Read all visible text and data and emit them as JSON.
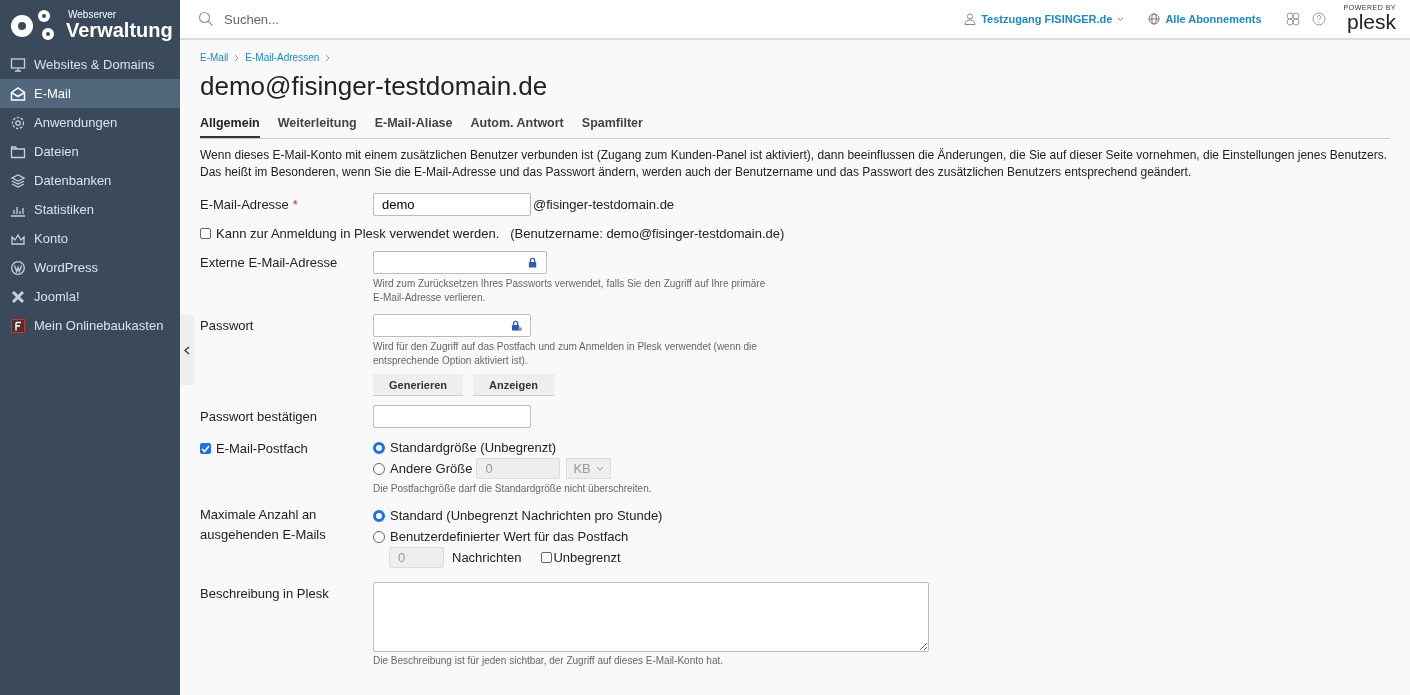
{
  "sidebar": {
    "logo": {
      "small": "Webserver",
      "big": "Verwaltung"
    },
    "items": [
      {
        "label": "Websites & Domains",
        "selected": false
      },
      {
        "label": "E-Mail",
        "selected": true
      },
      {
        "label": "Anwendungen",
        "selected": false
      },
      {
        "label": "Dateien",
        "selected": false
      },
      {
        "label": "Datenbanken",
        "selected": false
      },
      {
        "label": "Statistiken",
        "selected": false
      },
      {
        "label": "Konto",
        "selected": false
      },
      {
        "label": "WordPress",
        "selected": false
      },
      {
        "label": "Joomla!",
        "selected": false
      },
      {
        "label": "Mein Onlinebaukasten",
        "selected": false
      }
    ]
  },
  "topbar": {
    "search": {
      "placeholder": "Suchen..."
    },
    "user": "Testzugang FISINGER.de",
    "subscriptions": "Alle Abonnements",
    "powered_by": "POWERED BY",
    "brand": "plesk"
  },
  "breadcrumbs": [
    "E-Mail",
    "E-Mail-Adressen"
  ],
  "title": "demo@fisinger-testdomain.de",
  "tabs": [
    {
      "label": "Allgemein",
      "selected": true
    },
    {
      "label": "Weiterleitung",
      "selected": false
    },
    {
      "label": "E-Mail-Aliase",
      "selected": false
    },
    {
      "label": "Autom. Antwort",
      "selected": false
    },
    {
      "label": "Spamfilter",
      "selected": false
    }
  ],
  "intro": "Wenn dieses E-Mail-Konto mit einem zusätzlichen Benutzer verbunden ist (Zugang zum Kunden-Panel ist aktiviert), dann beeinflussen die Änderungen, die Sie auf dieser Seite vornehmen, die Einstellungen jenes Benutzers. Das heißt im Besonderen, wenn Sie die E-Mail-Adresse und das Passwort ändern, werden auch der Benutzername und das Passwort des zusätzlichen Benutzers entsprechend geändert.",
  "form": [
    {
      "kind": "address",
      "label": "E-Mail-Adresse",
      "required": "*",
      "value": "demo",
      "suffix": "@fisinger-testdomain.de"
    },
    {
      "kind": "check",
      "label": "Kann zur Anmeldung in Plesk verwendet werden.",
      "note": "(Benutzername: demo@fisinger-testdomain.de)",
      "checked": false
    },
    {
      "kind": "external",
      "label": "Externe E-Mail-Adresse",
      "hint": "Wird zum Zurücksetzen Ihres Passworts verwendet, falls Sie den Zugriff auf Ihre primäre E-Mail-Adresse verlieren."
    },
    {
      "kind": "password",
      "label": "Passwort",
      "hint": "Wird für den Zugriff auf das Postfach und zum Anmelden in Plesk verwendet (wenn die entsprechende Option aktiviert ist).",
      "buttons": [
        "Generieren",
        "Anzeigen"
      ]
    },
    {
      "kind": "input",
      "label": "Passwort bestätigen"
    },
    {
      "kind": "mailbox",
      "label": "E-Mail-Postfach",
      "checked": true,
      "options": [
        {
          "label": "Standardgröße (Unbegrenzt)",
          "selected": true
        },
        {
          "label": "Andere Größe",
          "selected": false,
          "value": "0",
          "unit": "KB"
        }
      ],
      "hint": "Die Postfachgröße darf die Standardgröße nicht überschreiten."
    },
    {
      "kind": "outgoing",
      "label": "Maximale Anzahl an ausgehenden E-Mails",
      "options": [
        {
          "label": "Standard (Unbegrenzt Nachrichten pro Stunde)",
          "selected": true
        },
        {
          "label": "Benutzerdefinierter Wert für das Postfach",
          "selected": false
        }
      ],
      "count": {
        "value": "0",
        "unit": "Nachrichten",
        "unlimited": {
          "label": "Unbegrenzt",
          "checked": false
        }
      }
    },
    {
      "kind": "textarea",
      "label": "Beschreibung in Plesk",
      "hint": "Die Beschreibung ist für jeden sichtbar, der Zugriff auf dieses E-Mail-Konto hat."
    }
  ]
}
